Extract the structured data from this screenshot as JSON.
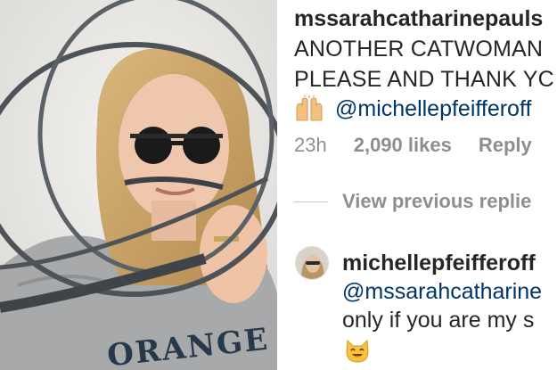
{
  "photo": {
    "shirt_text": "ORANGE",
    "icon": "photo-of-woman-with-whip"
  },
  "comment": {
    "username": "mssarahcatharinepauls",
    "line1": "ANOTHER CATWOMAN",
    "line2": "PLEASE AND THANK YC",
    "emoji": "raising-hands-emoji",
    "mention": "@michellepfeifferoff",
    "time": "23h",
    "likes": "2,090 likes",
    "reply_label": "Reply"
  },
  "view_previous_label": "View previous replie",
  "reply": {
    "username": "michellepfeifferoff",
    "mention": "@mssarahcatharine",
    "text": "only if you are my s",
    "emoji": "smiling-cat-emoji"
  },
  "colors": {
    "text": "#262626",
    "muted": "#8e8e8e",
    "mention": "#003569"
  }
}
